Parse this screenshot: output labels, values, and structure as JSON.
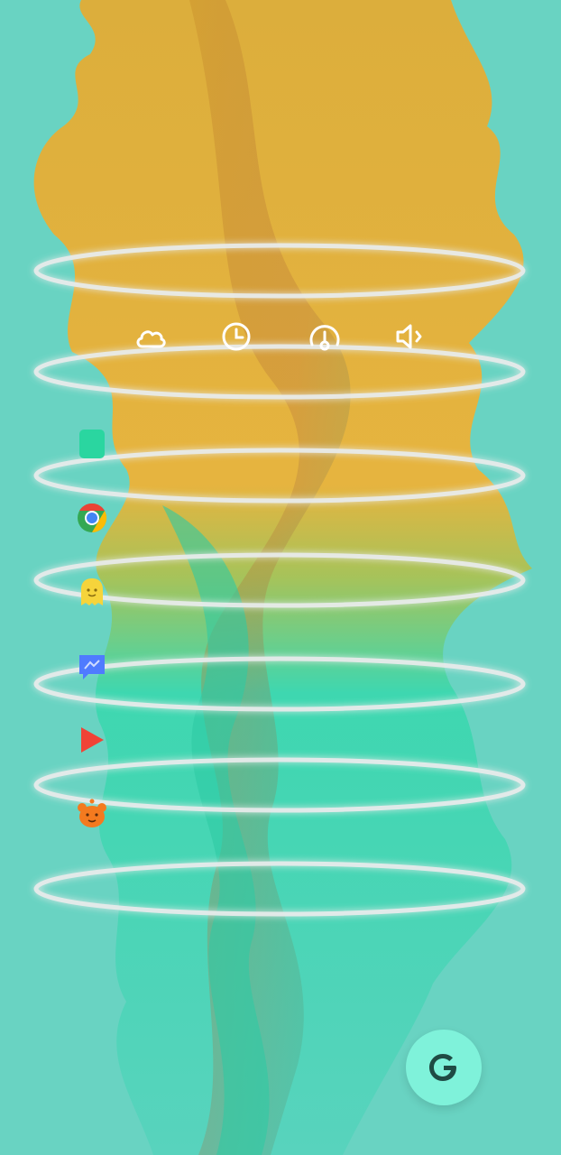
{
  "screen": {
    "name": "android-home-screen",
    "background_color": "#69d3c2",
    "wallpaper_colors": [
      "#e3b23c",
      "#3fd8b5",
      "#69d3c2"
    ]
  },
  "quick_widgets": [
    {
      "name": "weather",
      "icon": "cloud-icon"
    },
    {
      "name": "clock",
      "icon": "clock-icon"
    },
    {
      "name": "speed-test",
      "icon": "speedometer-icon"
    },
    {
      "name": "volume",
      "icon": "speaker-icon"
    }
  ],
  "dock_apps": [
    {
      "name": "green-square-app",
      "icon": "green-square-icon",
      "color": "#2ad6a0"
    },
    {
      "name": "chrome",
      "icon": "chrome-icon",
      "color": "#4285f4"
    },
    {
      "name": "snapchat-ghost-app",
      "icon": "ghost-icon",
      "color": "#f6d43b"
    },
    {
      "name": "messenger",
      "icon": "messenger-icon",
      "color": "#4f7bff"
    },
    {
      "name": "youtube-play",
      "icon": "play-icon",
      "color": "#f04336"
    },
    {
      "name": "bear-app",
      "icon": "bear-icon",
      "color": "#f47a1f"
    }
  ],
  "google_button": {
    "label": "G",
    "icon": "google-icon",
    "background": "#7ff2da",
    "foreground": "#1f4b44"
  }
}
